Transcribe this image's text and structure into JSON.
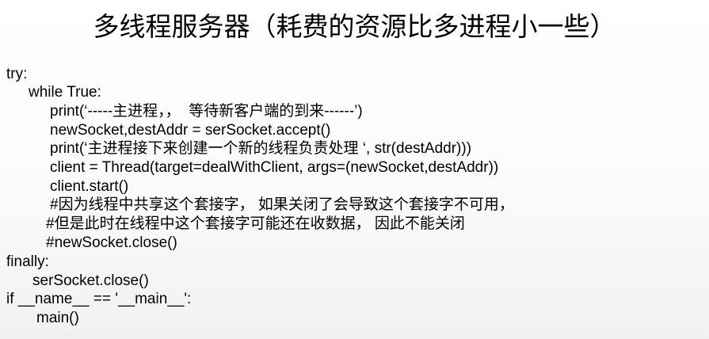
{
  "slide": {
    "title": "多线程服务器（耗费的资源比多进程小一些）",
    "code_lines": [
      "try:",
      "while True:",
      "print(‘-----主进程，，  等待新客户端的到来------’)",
      "newSocket,destAddr = serSocket.accept()",
      "print(‘主进程接下来创建一个新的线程负责处理 ‘, str(destAddr)))",
      "client = Thread(target=dealWithClient, args=(newSocket,destAddr))",
      "client.start()",
      "#因为线程中共享这个套接字， 如果关闭了会导致这个套接字不可用，",
      "#但是此时在线程中这个套接字可能还在收数据， 因此不能关闭",
      "#newSocket.close()",
      "finally:",
      "serSocket.close()",
      "if __name__ == '__main__':",
      "main()"
    ]
  }
}
